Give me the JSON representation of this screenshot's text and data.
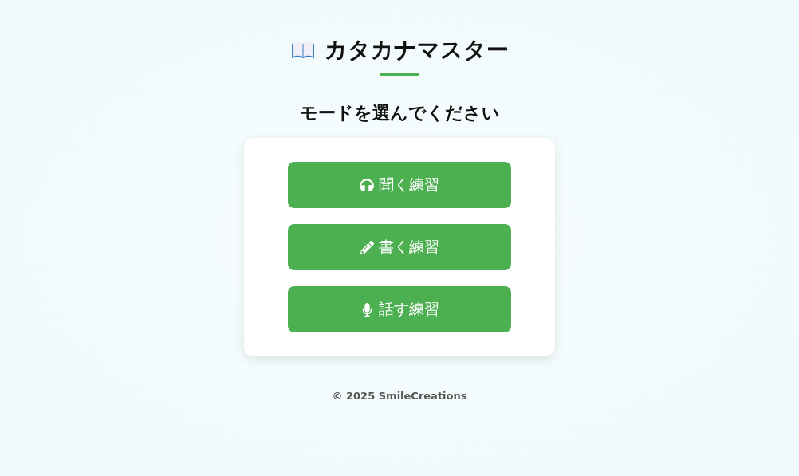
{
  "title": "カタカナマスター",
  "subtitle": "モードを選んでください",
  "modes": [
    {
      "kind": "listen",
      "label": "聞く練習"
    },
    {
      "kind": "write",
      "label": "書く練習"
    },
    {
      "kind": "speak",
      "label": "話す練習"
    }
  ],
  "footer": "© 2025 SmileCreations"
}
